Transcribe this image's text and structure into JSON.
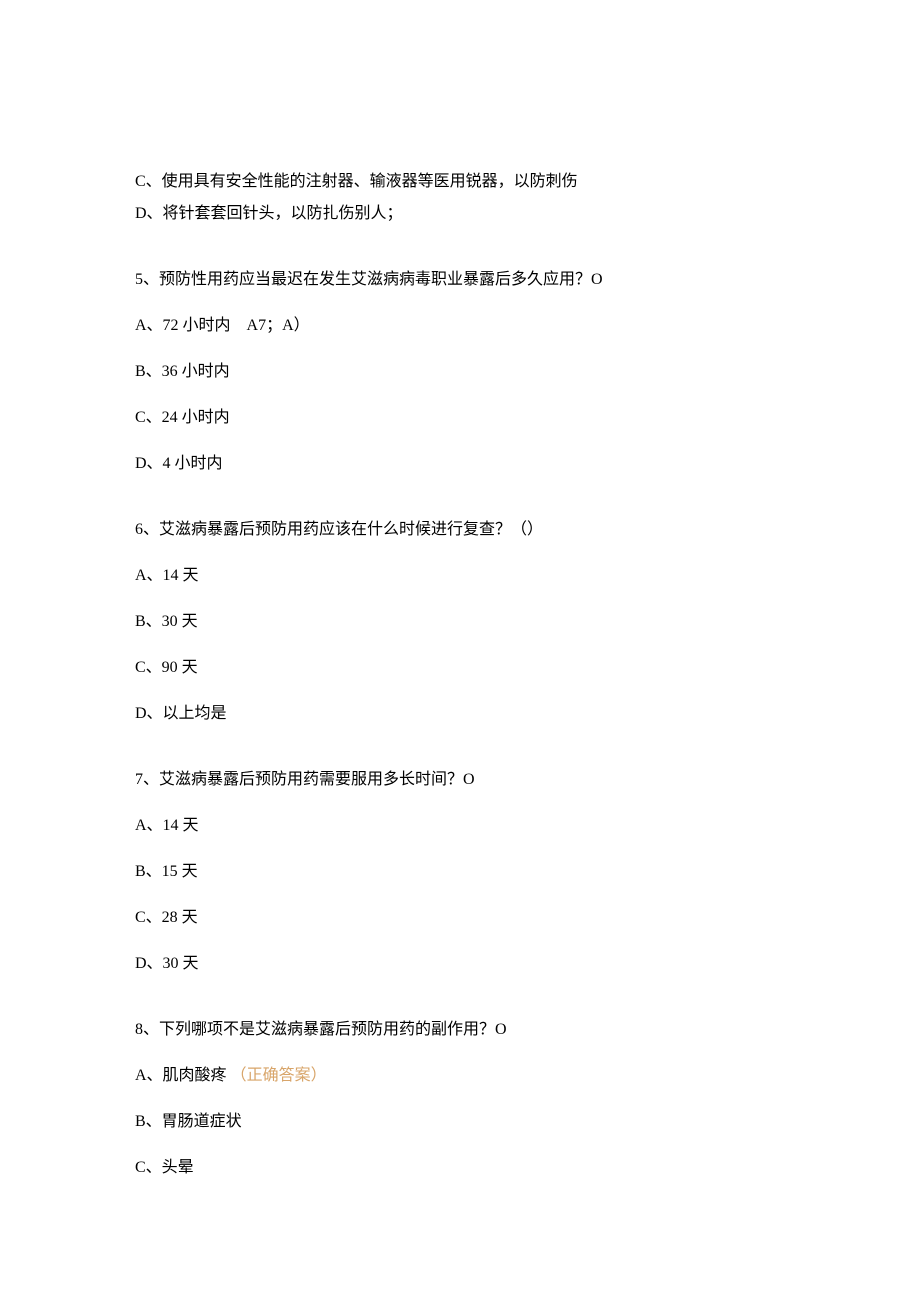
{
  "q4_optC": "C、使用具有安全性能的注射器、输液器等医用锐器，以防刺伤",
  "q4_optD": "D、将针套套回针头，以防扎伤别人；",
  "q5_stem": "5、预防性用药应当最迟在发生艾滋病病毒职业暴露后多久应用？O",
  "q5_optA": "A、72 小时内 A7；A）",
  "q5_optB": "B、36 小时内",
  "q5_optC": "C、24 小时内",
  "q5_optD": "D、4 小时内",
  "q6_stem": "6、艾滋病暴露后预防用药应该在什么时候进行复查？（）",
  "q6_optA": "A、14 天",
  "q6_optB": "B、30 天",
  "q6_optC": "C、90 天",
  "q6_optD": "D、以上均是",
  "q7_stem": "7、艾滋病暴露后预防用药需要服用多长时间？O",
  "q7_optA": "A、14 天",
  "q7_optB": "B、15 天",
  "q7_optC": "C、28 天",
  "q7_optD": "D、30 天",
  "q8_stem": "8、下列哪项不是艾滋病暴露后预防用药的副作用？O",
  "q8_optA_prefix": "A、肌肉酸疼",
  "q8_optA_note": "（正确答案）",
  "q8_optB": "B、胃肠道症状",
  "q8_optC": "C、头晕"
}
